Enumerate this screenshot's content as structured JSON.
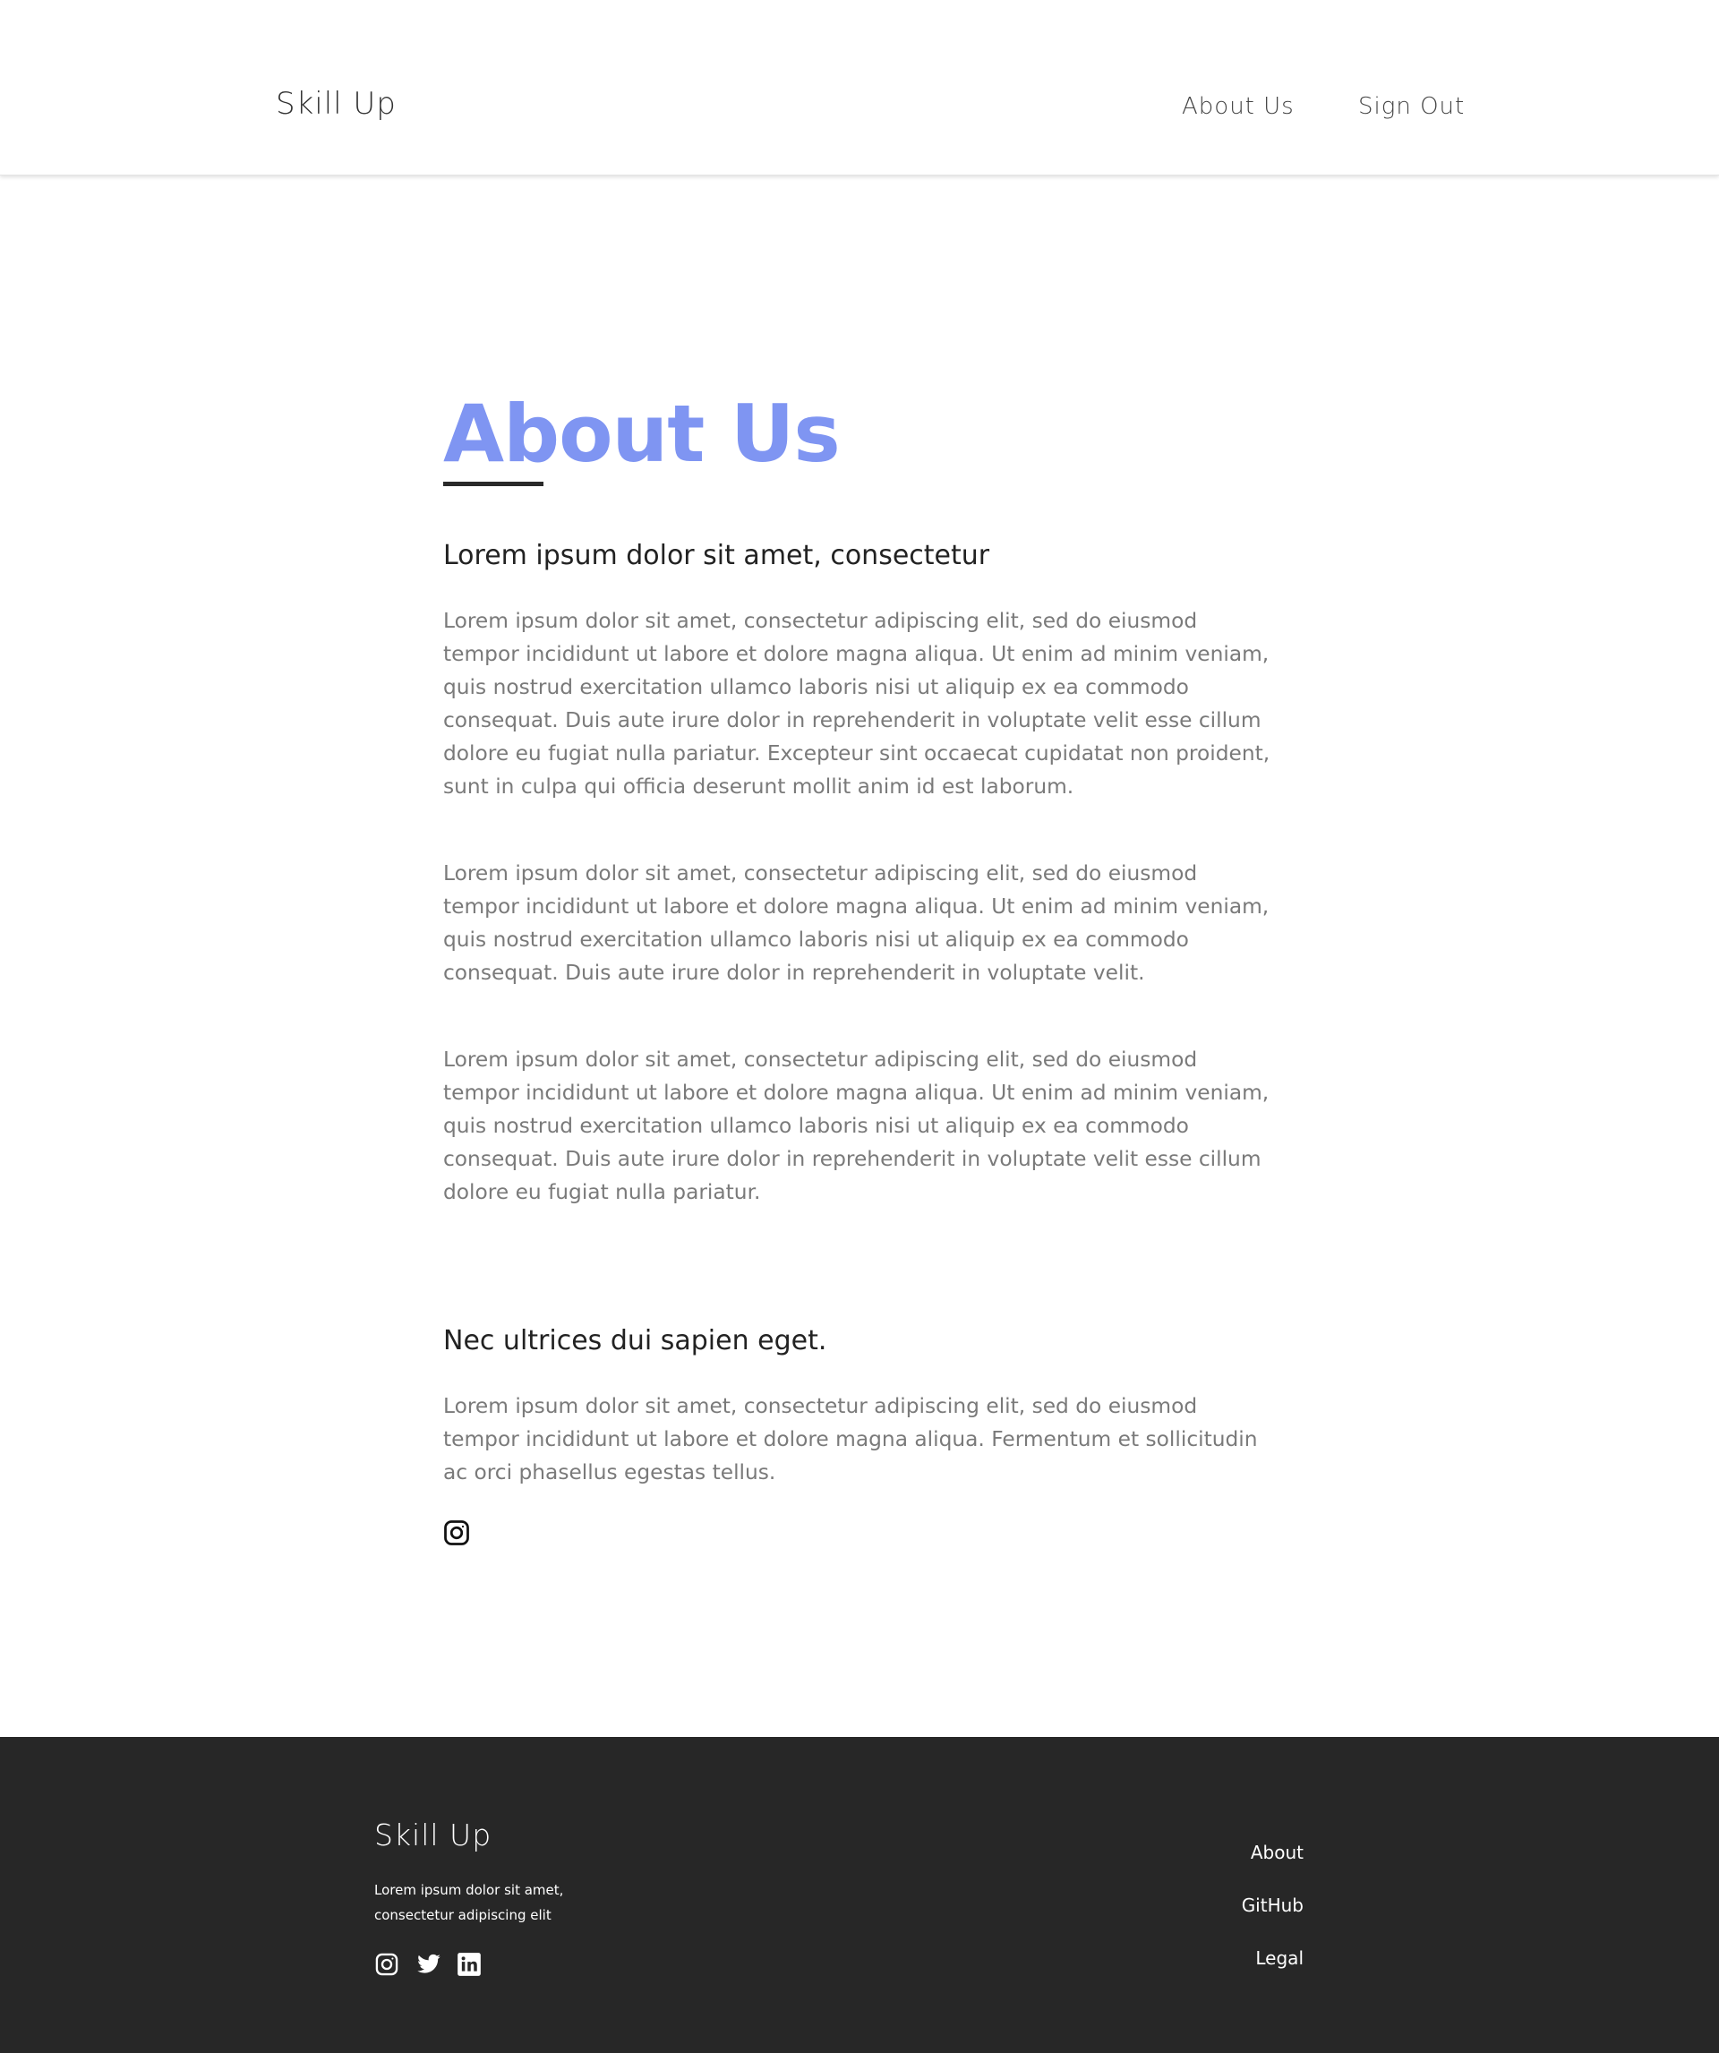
{
  "header": {
    "brand": "Skill Up",
    "nav": [
      {
        "label": "About Us"
      },
      {
        "label": "Sign Out"
      }
    ]
  },
  "main": {
    "title": "About Us",
    "title_color": "#7f95f2",
    "sections": [
      {
        "heading": "Lorem ipsum dolor sit amet, consectetur",
        "paragraphs": [
          "Lorem ipsum dolor sit amet, consectetur adipiscing elit, sed do eiusmod tempor incididunt ut labore et dolore magna aliqua. Ut enim ad minim veniam, quis nostrud exercitation ullamco laboris nisi ut aliquip ex ea commodo consequat. Duis aute irure dolor in reprehenderit in voluptate velit esse cillum dolore eu fugiat nulla pariatur. Excepteur sint occaecat cupidatat non proident, sunt in culpa qui officia deserunt mollit anim id est laborum.",
          "Lorem ipsum dolor sit amet, consectetur adipiscing elit, sed do eiusmod tempor incididunt ut labore et dolore magna aliqua. Ut enim ad minim veniam, quis nostrud exercitation ullamco laboris nisi ut aliquip ex ea commodo consequat. Duis aute irure dolor in reprehenderit in voluptate velit.",
          "Lorem ipsum dolor sit amet, consectetur adipiscing elit, sed do eiusmod tempor incididunt ut labore et dolore magna aliqua. Ut enim ad minim veniam, quis nostrud exercitation ullamco laboris nisi ut aliquip ex ea commodo consequat. Duis aute irure dolor in reprehenderit in voluptate velit esse cillum dolore eu fugiat nulla pariatur."
        ]
      },
      {
        "heading": "Nec ultrices dui sapien eget.",
        "paragraphs": [
          "Lorem ipsum dolor sit amet, consectetur adipiscing elit, sed do eiusmod tempor incididunt ut labore et dolore magna aliqua. Fermentum et sollicitudin ac orci phasellus egestas tellus."
        ],
        "icon": "instagram-icon"
      }
    ]
  },
  "footer": {
    "brand": "Skill Up",
    "tagline": "Lorem ipsum dolor sit amet, consectetur adipiscing elit",
    "social_icons": [
      "instagram-icon",
      "twitter-icon",
      "linkedin-icon"
    ],
    "links": [
      {
        "label": "About"
      },
      {
        "label": "GitHub"
      },
      {
        "label": "Legal"
      }
    ],
    "background": "#272727"
  }
}
